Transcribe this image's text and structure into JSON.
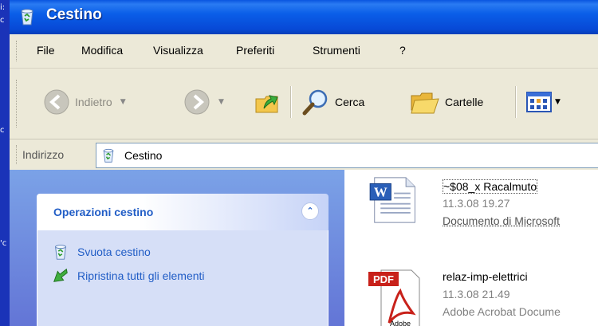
{
  "window": {
    "title": "Cestino"
  },
  "menu": [
    "File",
    "Modifica",
    "Visualizza",
    "Preferiti",
    "Strumenti",
    "?"
  ],
  "toolbar": {
    "back_label": "Indietro",
    "search_label": "Cerca",
    "folders_label": "Cartelle"
  },
  "address": {
    "label": "Indirizzo",
    "value": "Cestino"
  },
  "taskpane": {
    "title": "Operazioni cestino",
    "links": [
      "Svuota cestino",
      "Ripristina tutti gli elementi"
    ]
  },
  "files": [
    {
      "name": "~$08_x Racalmuto",
      "date": "11.3.08 19.27",
      "type": "Documento di Microsoft",
      "icon": "word-document-icon"
    },
    {
      "name": "relaz-imp-elettrici",
      "date": "11.3.08 21.49",
      "type": "Adobe Acrobat Docume",
      "icon": "pdf-document-icon"
    }
  ],
  "colors": {
    "titlebar": "#0a5ee8",
    "taskpane_link": "#215dc6",
    "sidepane_bg": "#7ba2e7"
  }
}
